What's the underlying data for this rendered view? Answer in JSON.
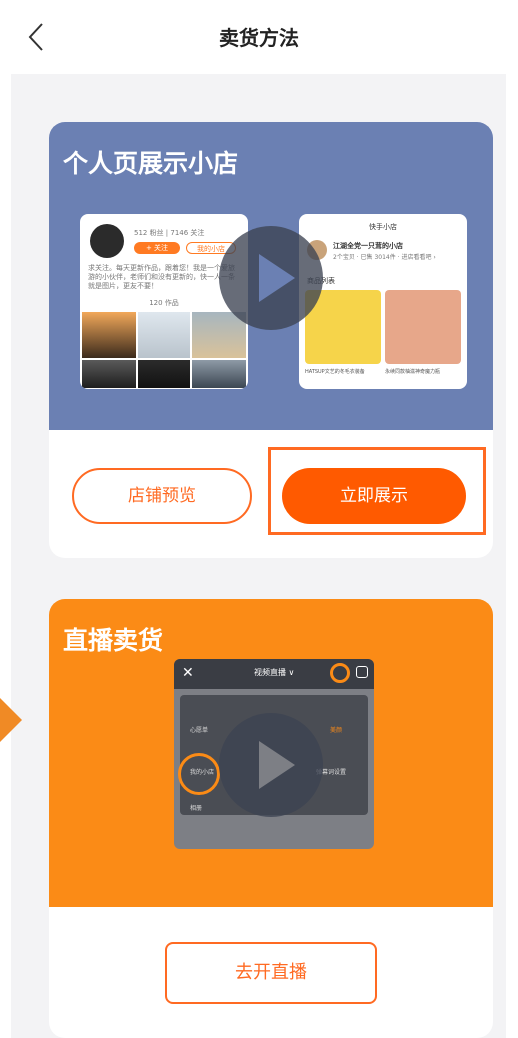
{
  "header": {
    "title": "卖货方法",
    "back_icon": "chevron-left-icon"
  },
  "card_profile_shop": {
    "title": "个人页展示小店",
    "preview_left": {
      "stats": "512 粉丝 | 7146 关注",
      "tag1": "+ 关注",
      "tag2": "我的小店",
      "bio": "求关注。每天更新作品，跟着您！我是一个爱旅游的小伙伴，老师们和没有更新的，快一人一条就是图片，更友不要！",
      "works_count": "120 作品"
    },
    "preview_right": {
      "header_title": "快手小店",
      "shop_name": "江湖全党一只茸的小店",
      "shop_sub": "2个宝贝 · 已售 3014件 · 进店看看吧 ›",
      "section_label": "商品列表",
      "item1_caption": "HATSUP文艺的冬毛衣装备",
      "item2_caption": "永续同款柚滋神奇魔力瓶"
    },
    "preview_button": "店铺预览",
    "show_button": "立即展示",
    "accent_color": "#6b80b3"
  },
  "card_live_selling": {
    "title": "直播卖货",
    "preview": {
      "top_label": "视频直播 ∨",
      "items": [
        "心愿单",
        "音乐",
        "小程序",
        "美颜",
        "我的小店",
        "语音交流",
        "商品推荐",
        "弹幕词设置",
        "相册"
      ]
    },
    "go_live_button": "去开直播",
    "accent_color": "#fb8b16"
  }
}
